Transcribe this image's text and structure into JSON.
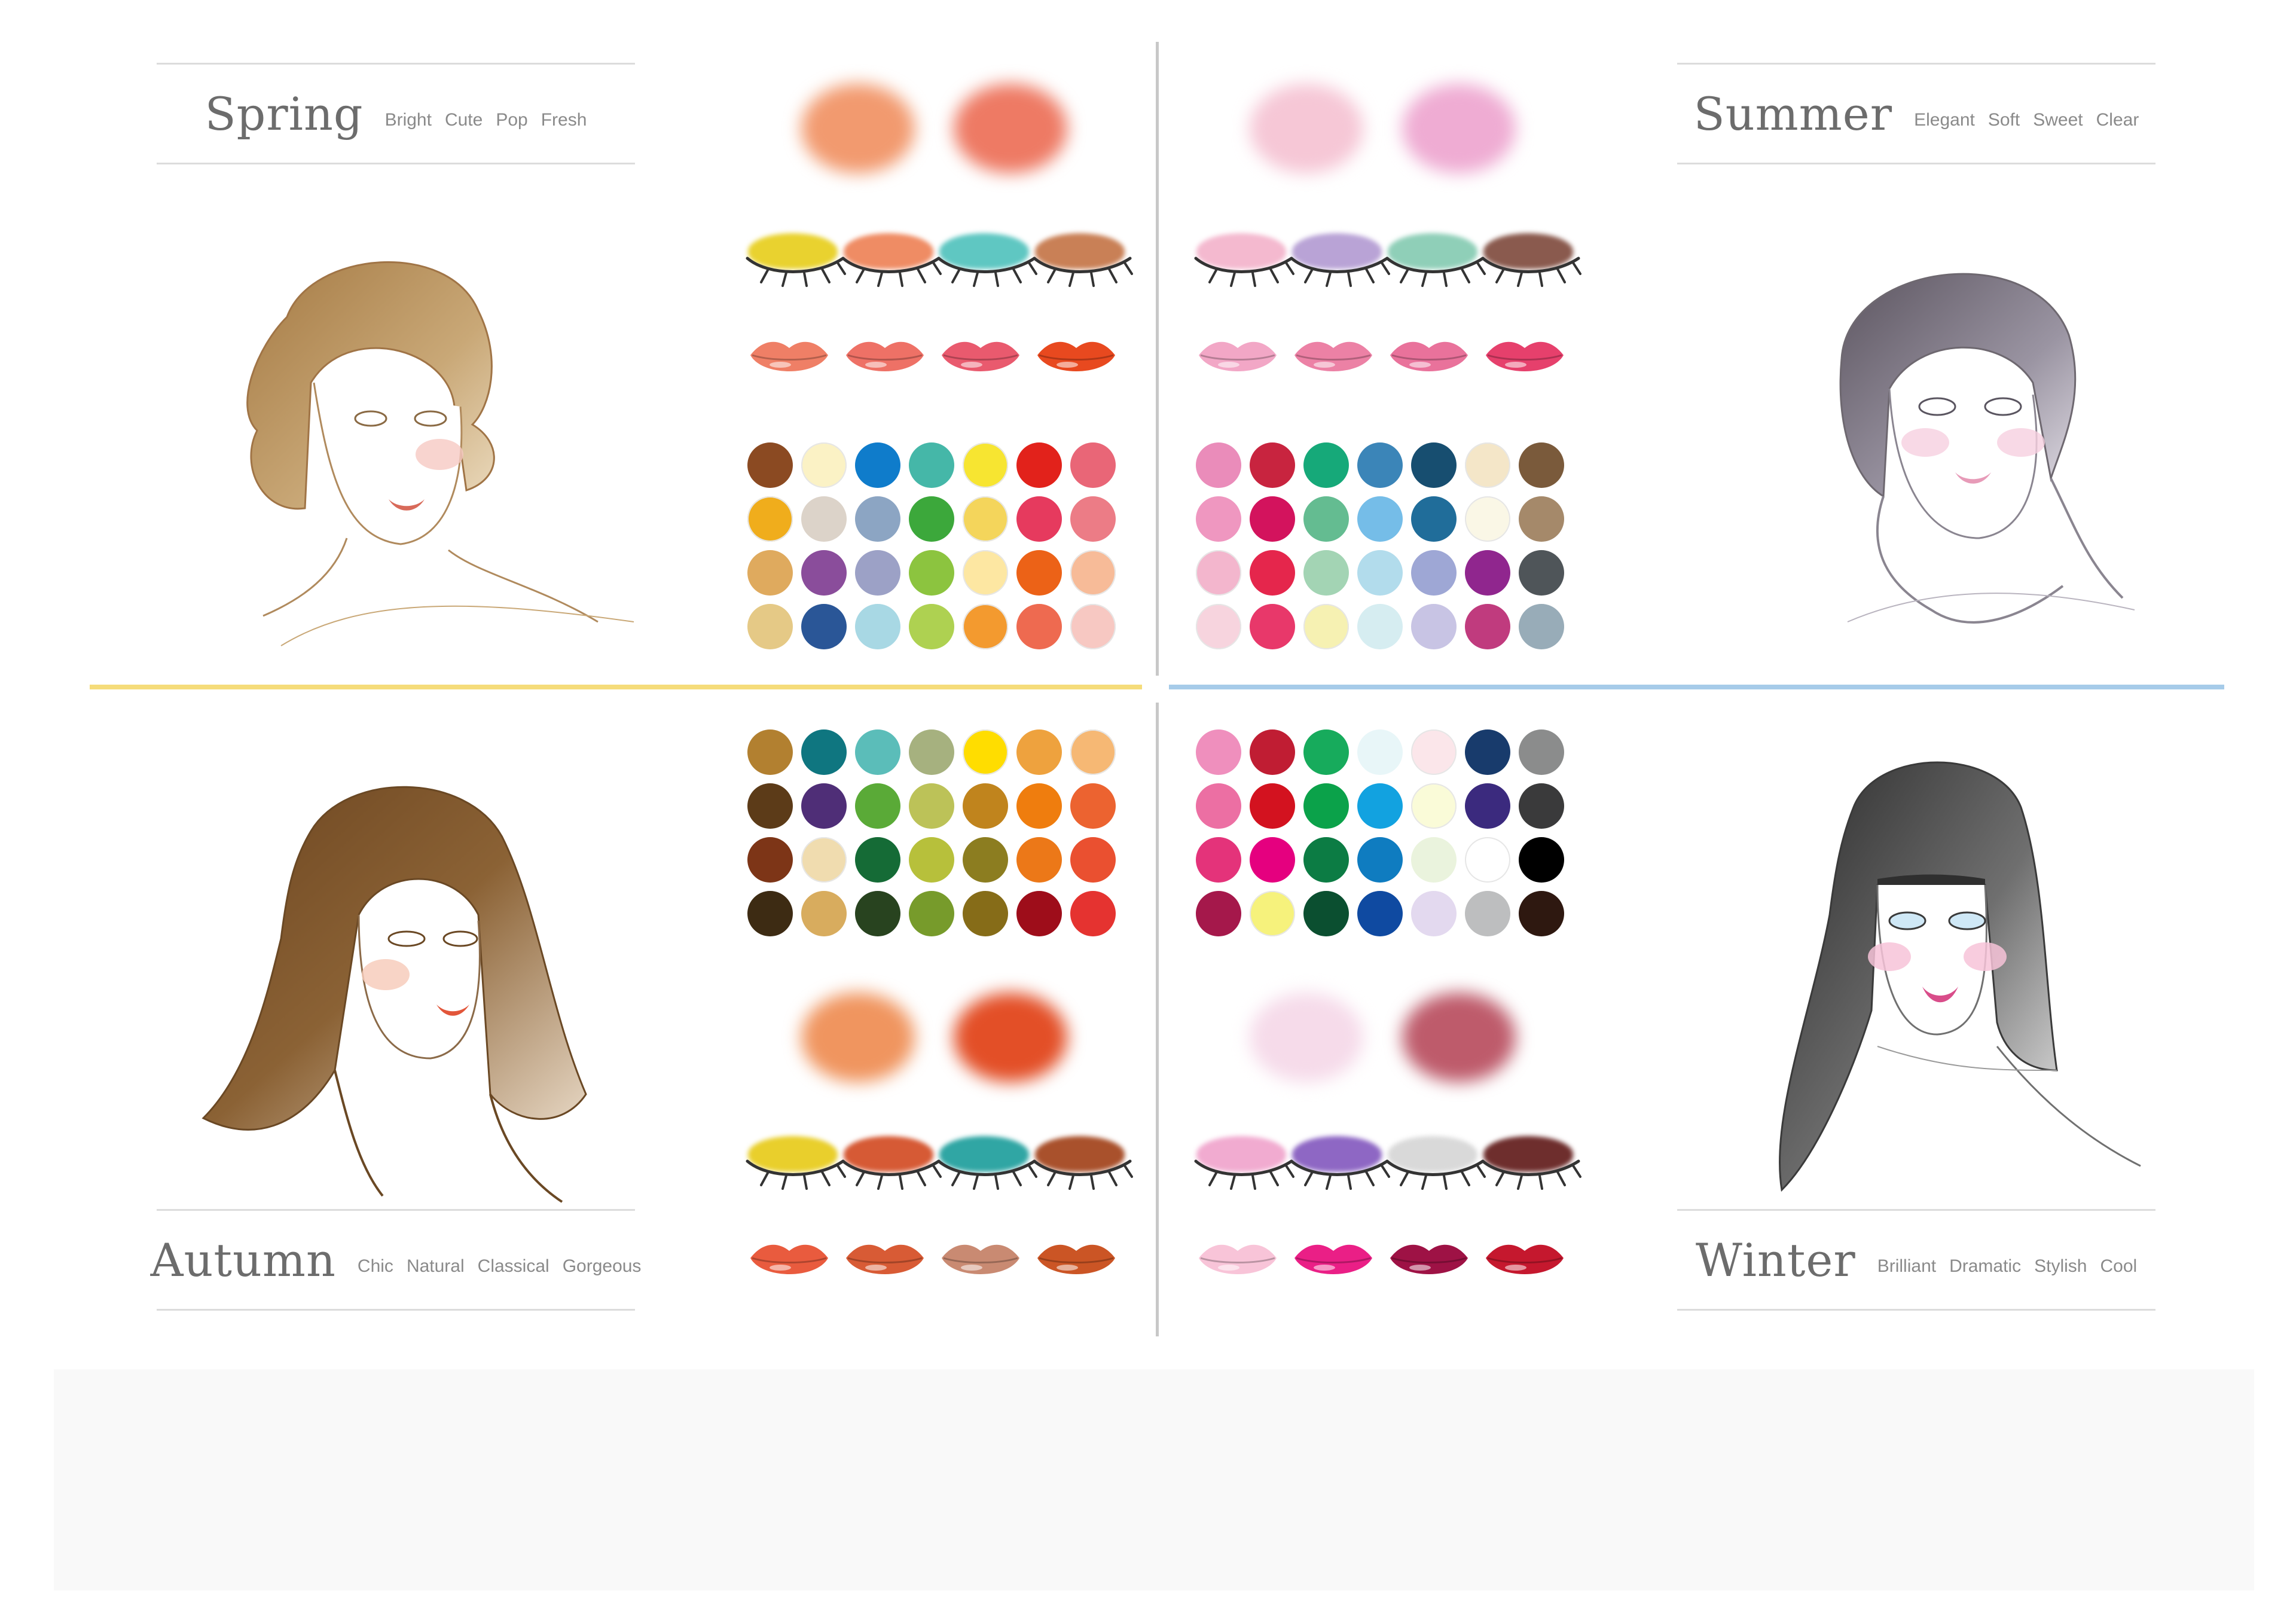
{
  "seasons": {
    "spring": {
      "title": "Spring",
      "tags": [
        "Bright",
        "Cute",
        "Pop",
        "Fresh"
      ],
      "accent": "#f5dc7a",
      "blush": [
        "#f29a6f",
        "#ee7a64"
      ],
      "eyeshadow": [
        "#e9d22f",
        "#ef8c64",
        "#5fc7c2",
        "#c98056"
      ],
      "lips": [
        "#ef7f66",
        "#ee7166",
        "#e95a6e",
        "#e8491f"
      ],
      "swatches": [
        [
          "#8b4a22",
          "#fbf2c5",
          "#0f7ccb",
          "#45b7a8",
          "#f7e531",
          "#e2221b",
          "#e96677"
        ],
        [
          "#f0ad1c",
          "#dcd3c9",
          "#8ca5c3",
          "#3ca83b",
          "#f4d55b",
          "#e63a5e",
          "#ec7c86"
        ],
        [
          "#dfaa5e",
          "#8a4d9b",
          "#9ca1c6",
          "#8cc43f",
          "#fde7a2",
          "#ec6217",
          "#f7bb98"
        ],
        [
          "#e5c986",
          "#2a5697",
          "#a8d8e4",
          "#aed151",
          "#f39a2f",
          "#ee6a50",
          "#f7c8c2"
        ]
      ]
    },
    "summer": {
      "title": "Summer",
      "tags": [
        "Elegant",
        "Soft",
        "Sweet",
        "Clear"
      ],
      "accent": "#a6cbe9",
      "blush": [
        "#f6c7d6",
        "#efacd3"
      ],
      "eyeshadow": [
        "#f4b9cf",
        "#b9a3d6",
        "#8fcfb8",
        "#8a5a4e"
      ],
      "lips": [
        "#f2a7c6",
        "#ec81a5",
        "#e9729b",
        "#e6406c"
      ],
      "swatches": [
        [
          "#ea8cba",
          "#c8243f",
          "#16a979",
          "#3b85b8",
          "#174e70",
          "#f4e6c8",
          "#7a5a3b"
        ],
        [
          "#ef97c0",
          "#d3135d",
          "#64bc91",
          "#75bde8",
          "#206d9a",
          "#faf7e6",
          "#a5896a"
        ],
        [
          "#f3b6cd",
          "#e5264c",
          "#a3d4b4",
          "#b2dcec",
          "#9ea7d5",
          "#90268e",
          "#4f5559"
        ],
        [
          "#f7d4de",
          "#e8386a",
          "#f6f1b2",
          "#d6edf1",
          "#c8c4e4",
          "#c03b7e",
          "#98acb8"
        ]
      ]
    },
    "autumn": {
      "title": "Autumn",
      "tags": [
        "Chic",
        "Natural",
        "Classical",
        "Gorgeous"
      ],
      "accent": "#f5dc7a",
      "blush": [
        "#f0955f",
        "#e34f27"
      ],
      "eyeshadow": [
        "#e9cf2c",
        "#d65a35",
        "#30a6a4",
        "#a9512c"
      ],
      "lips": [
        "#e95b3e",
        "#d85b35",
        "#c98a72",
        "#cb5525"
      ],
      "swatches": [
        [
          "#b28030",
          "#0f7680",
          "#5bbdb9",
          "#a6b17f",
          "#ffdd00",
          "#eea23e",
          "#f6b874"
        ],
        [
          "#5c3b18",
          "#4f2e77",
          "#5aaa37",
          "#bcc258",
          "#c0841d",
          "#ef7d0e",
          "#ec6330"
        ],
        [
          "#7d3517",
          "#f0dcaf",
          "#156b36",
          "#b7c03b",
          "#8c7d20",
          "#ec7818",
          "#ea5030"
        ],
        [
          "#3d2b13",
          "#d8ac5e",
          "#28431f",
          "#779b2b",
          "#866c18",
          "#9e0d1a",
          "#e53330"
        ]
      ]
    },
    "winter": {
      "title": "Winter",
      "tags": [
        "Brilliant",
        "Dramatic",
        "Stylish",
        "Cool"
      ],
      "accent": "#a6cbe9",
      "blush": [
        "#f6dbea",
        "#be5b6b"
      ],
      "eyeshadow": [
        "#f1abd0",
        "#8e67c4",
        "#d9d9d9",
        "#6e2e2d"
      ],
      "lips": [
        "#f8c4d8",
        "#ea1f86",
        "#9e1245",
        "#c5182e"
      ],
      "swatches": [
        [
          "#ef8fbd",
          "#c01d33",
          "#17ab5c",
          "#e8f6f8",
          "#fbe6ea",
          "#183b6c",
          "#8b8c8c"
        ],
        [
          "#ec6fa3",
          "#d3121f",
          "#0ba24a",
          "#12a2e0",
          "#fafbd8",
          "#3b2a7e",
          "#3a3a3b"
        ],
        [
          "#e4337a",
          "#e5007f",
          "#0c7c44",
          "#0f7cc0",
          "#eaf3dd",
          "#ffffff",
          "#000000"
        ],
        [
          "#a5184b",
          "#f6f27c",
          "#0b4f30",
          "#0f4aa1",
          "#e3d9ef",
          "#bdbebf",
          "#2e1810"
        ]
      ]
    }
  }
}
